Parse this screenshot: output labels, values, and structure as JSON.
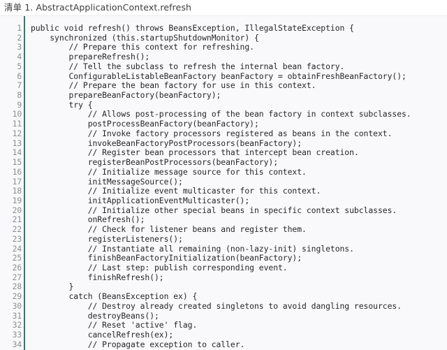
{
  "caption": {
    "label": "清单 1. AbstractApplicationContext.refresh"
  },
  "colors": {
    "gutter_rule": "#2f7d72",
    "code_background": "#f9f9fb",
    "page_background": "#ffffff",
    "line_number": "#8d8d94",
    "code_text": "#26262a",
    "caption_text": "#3b3b3b"
  },
  "code": {
    "language": "java",
    "first_line_number": 1,
    "total_visible_lines": 34,
    "lines": [
      {
        "n": "1",
        "text": "public void refresh() throws BeansException, IllegalStateException {"
      },
      {
        "n": "2",
        "text": "    synchronized (this.startupShutdownMonitor) {"
      },
      {
        "n": "3",
        "text": "        // Prepare this context for refreshing."
      },
      {
        "n": "4",
        "text": "        prepareRefresh();"
      },
      {
        "n": "5",
        "text": "        // Tell the subclass to refresh the internal bean factory."
      },
      {
        "n": "6",
        "text": "        ConfigurableListableBeanFactory beanFactory = obtainFreshBeanFactory();"
      },
      {
        "n": "7",
        "text": "        // Prepare the bean factory for use in this context."
      },
      {
        "n": "8",
        "text": "        prepareBeanFactory(beanFactory);"
      },
      {
        "n": "9",
        "text": "        try {"
      },
      {
        "n": "10",
        "text": "            // Allows post-processing of the bean factory in context subclasses."
      },
      {
        "n": "11",
        "text": "            postProcessBeanFactory(beanFactory);"
      },
      {
        "n": "12",
        "text": "            // Invoke factory processors registered as beans in the context."
      },
      {
        "n": "13",
        "text": "            invokeBeanFactoryPostProcessors(beanFactory);"
      },
      {
        "n": "14",
        "text": "            // Register bean processors that intercept bean creation."
      },
      {
        "n": "15",
        "text": "            registerBeanPostProcessors(beanFactory);"
      },
      {
        "n": "16",
        "text": "            // Initialize message source for this context."
      },
      {
        "n": "17",
        "text": "            initMessageSource();"
      },
      {
        "n": "18",
        "text": "            // Initialize event multicaster for this context."
      },
      {
        "n": "19",
        "text": "            initApplicationEventMulticaster();"
      },
      {
        "n": "20",
        "text": "            // Initialize other special beans in specific context subclasses."
      },
      {
        "n": "21",
        "text": "            onRefresh();"
      },
      {
        "n": "22",
        "text": "            // Check for listener beans and register them."
      },
      {
        "n": "23",
        "text": "            registerListeners();"
      },
      {
        "n": "24",
        "text": "            // Instantiate all remaining (non-lazy-init) singletons."
      },
      {
        "n": "25",
        "text": "            finishBeanFactoryInitialization(beanFactory);"
      },
      {
        "n": "26",
        "text": "            // Last step: publish corresponding event."
      },
      {
        "n": "27",
        "text": "            finishRefresh();"
      },
      {
        "n": "28",
        "text": "        }"
      },
      {
        "n": "29",
        "text": "        catch (BeansException ex) {"
      },
      {
        "n": "30",
        "text": "            // Destroy already created singletons to avoid dangling resources."
      },
      {
        "n": "31",
        "text": "            destroyBeans();"
      },
      {
        "n": "32",
        "text": "            // Reset 'active' flag."
      },
      {
        "n": "33",
        "text": "            cancelRefresh(ex);"
      },
      {
        "n": "34",
        "text": "            // Propagate exception to caller."
      }
    ]
  }
}
